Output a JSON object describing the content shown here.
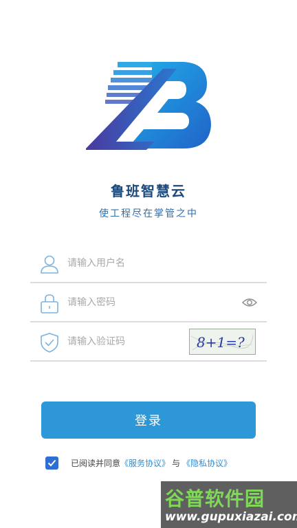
{
  "app": {
    "name": "鲁班智慧云",
    "slogan": "使工程尽在掌管之中"
  },
  "form": {
    "username": {
      "placeholder": "请输入用户名",
      "value": "",
      "icon": "user-icon"
    },
    "password": {
      "placeholder": "请输入密码",
      "value": "",
      "icon": "lock-icon",
      "toggle_icon": "eye-icon"
    },
    "captcha": {
      "placeholder": "请输入验证码",
      "value": "",
      "icon": "shield-check-icon",
      "image_text": "8+1=?"
    }
  },
  "login_button": {
    "label": "登录"
  },
  "agreement": {
    "checked": true,
    "prefix": "已阅读并同意",
    "service_link": "《服务协议》",
    "connector": "与",
    "privacy_link": "《隐私协议》"
  },
  "watermark": {
    "title": "谷普软件园",
    "url": "www.gupuxiazai.com"
  },
  "colors": {
    "brand_blue": "#2e97d8",
    "title_blue": "#1c4a7c",
    "link_blue": "#2d8ed0",
    "checkbox_blue": "#2f6fd1"
  }
}
